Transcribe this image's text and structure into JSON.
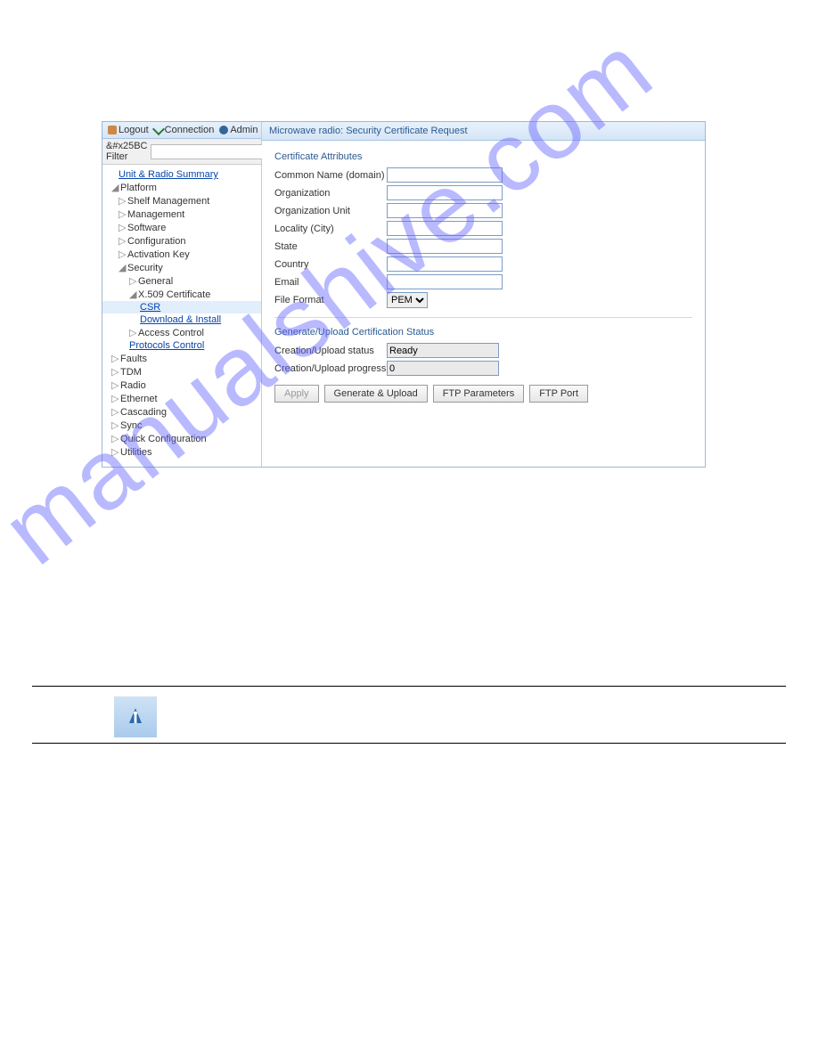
{
  "toolbar": {
    "logout": "Logout",
    "connection": "Connection",
    "admin": "Admin"
  },
  "filter": {
    "label": "&#x25BC Filter",
    "value": ""
  },
  "tree": {
    "unit_radio": "Unit & Radio Summary",
    "platform": "Platform",
    "shelf": "Shelf Management",
    "management": "Management",
    "software": "Software",
    "configuration": "Configuration",
    "activation": "Activation Key",
    "security": "Security",
    "general": "General",
    "x509": "X.509 Certificate",
    "csr": "CSR",
    "download": "Download & Install",
    "access": "Access Control",
    "protocols": "Protocols Control",
    "faults": "Faults",
    "tdm": "TDM",
    "radio": "Radio",
    "ethernet": "Ethernet",
    "cascading": "Cascading",
    "sync": "Sync",
    "quick": "Quick Configuration",
    "utilities": "Utilities"
  },
  "main": {
    "title": "Microwave radio: Security Certificate Request",
    "cert_section": "Certificate Attributes",
    "common_name": "Common Name (domain)",
    "organization": "Organization",
    "org_unit": "Organization Unit",
    "locality": "Locality (City)",
    "state": "State",
    "country": "Country",
    "email": "Email",
    "file_format": "File Format",
    "file_format_value": "PEM",
    "status_section": "Generate/Upload Certification Status",
    "status_label": "Creation/Upload status",
    "status_value": "Ready",
    "progress_label": "Creation/Upload progress",
    "progress_value": "0",
    "btn_apply": "Apply",
    "btn_generate": "Generate & Upload",
    "btn_ftp_params": "FTP Parameters",
    "btn_ftp_port": "FTP Port"
  },
  "watermark": "manualshive.com"
}
